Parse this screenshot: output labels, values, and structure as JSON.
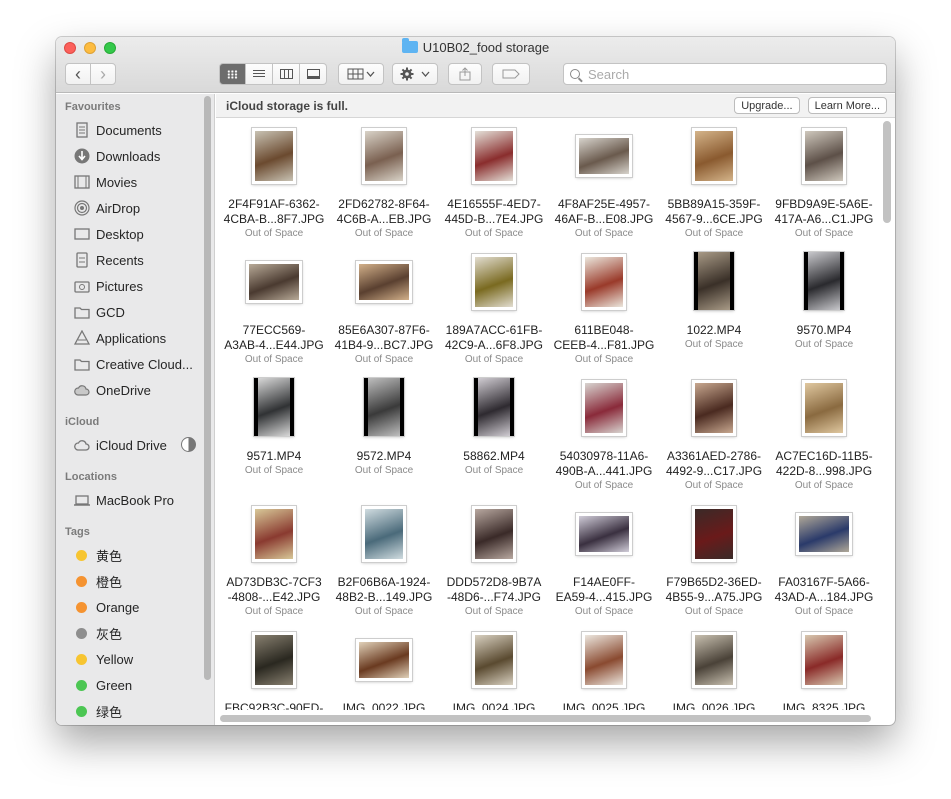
{
  "window": {
    "title": "U10B02_food storage"
  },
  "toolbar": {
    "back": "‹",
    "forward": "›",
    "search_placeholder": "Search"
  },
  "sidebar": {
    "favourites_heading": "Favourites",
    "favourites": [
      {
        "label": "Documents",
        "icon": "document-icon"
      },
      {
        "label": "Downloads",
        "icon": "download-icon"
      },
      {
        "label": "Movies",
        "icon": "film-icon"
      },
      {
        "label": "AirDrop",
        "icon": "airdrop-icon"
      },
      {
        "label": "Desktop",
        "icon": "desktop-icon"
      },
      {
        "label": "Recents",
        "icon": "clock-icon"
      },
      {
        "label": "Pictures",
        "icon": "camera-icon"
      },
      {
        "label": "GCD",
        "icon": "folder-icon"
      },
      {
        "label": "Applications",
        "icon": "applications-icon"
      },
      {
        "label": "Creative Cloud...",
        "icon": "folder-icon"
      },
      {
        "label": "OneDrive",
        "icon": "cloud-icon"
      }
    ],
    "icloud_heading": "iCloud",
    "icloud_drive": "iCloud Drive",
    "locations_heading": "Locations",
    "macbook": "MacBook Pro",
    "tags_heading": "Tags",
    "tags": [
      {
        "label": "黄色",
        "color": "#f7c531"
      },
      {
        "label": "橙色",
        "color": "#f59331"
      },
      {
        "label": "Orange",
        "color": "#f59331"
      },
      {
        "label": "灰色",
        "color": "#8e8e8e"
      },
      {
        "label": "Yellow",
        "color": "#f7c531"
      },
      {
        "label": "Green",
        "color": "#4cc653"
      },
      {
        "label": "绿色",
        "color": "#4cc653"
      }
    ]
  },
  "banner": {
    "message": "iCloud storage is full.",
    "upgrade": "Upgrade...",
    "learn_more": "Learn More..."
  },
  "files": [
    {
      "l1": "2F4F91AF-6362-",
      "l2": "4CBA-B...8F7.JPG",
      "status": "Out of Space",
      "shape": "portrait",
      "tone": [
        "#6b4a2f",
        "#c8c2b3"
      ]
    },
    {
      "l1": "2FD62782-8F64-",
      "l2": "4C6B-A...EB.JPG",
      "status": "Out of Space",
      "shape": "portrait",
      "tone": [
        "#7a6050",
        "#d9d3c8"
      ]
    },
    {
      "l1": "4E16555F-4ED7-",
      "l2": "445D-B...7E4.JPG",
      "status": "Out of Space",
      "shape": "portrait",
      "tone": [
        "#8a2d2d",
        "#e4e0d8"
      ]
    },
    {
      "l1": "4F8AF25E-4957-",
      "l2": "46AF-B...E08.JPG",
      "status": "Out of Space",
      "shape": "landscape",
      "tone": [
        "#6a5a4d",
        "#d7d3cc"
      ]
    },
    {
      "l1": "5BB89A15-359F-",
      "l2": "4567-9...6CE.JPG",
      "status": "Out of Space",
      "shape": "portrait",
      "tone": [
        "#8a5a2f",
        "#d4b48a"
      ]
    },
    {
      "l1": "9FBD9A9E-5A6E-",
      "l2": "417A-A6...C1.JPG",
      "status": "Out of Space",
      "shape": "portrait",
      "tone": [
        "#5d5048",
        "#cfc8bd"
      ]
    },
    {
      "l1": "77ECC569-",
      "l2": "A3AB-4...E44.JPG",
      "status": "Out of Space",
      "shape": "landscape",
      "tone": [
        "#4a3a30",
        "#b8aa98"
      ]
    },
    {
      "l1": "85E6A307-87F6-",
      "l2": "41B4-9...BC7.JPG",
      "status": "Out of Space",
      "shape": "landscape",
      "tone": [
        "#5a4030",
        "#d2b08a"
      ]
    },
    {
      "l1": "189A7ACC-61FB-",
      "l2": "42C9-A...6F8.JPG",
      "status": "Out of Space",
      "shape": "portrait",
      "tone": [
        "#7a6a20",
        "#e2ddd0"
      ]
    },
    {
      "l1": "611BE048-",
      "l2": "CEEB-4...F81.JPG",
      "status": "Out of Space",
      "shape": "portrait",
      "tone": [
        "#9a3a2a",
        "#ebe6dc"
      ]
    },
    {
      "l1": "1022.MP4",
      "l2": "",
      "status": "Out of Space",
      "shape": "video",
      "tone": [
        "#3a3028",
        "#a89a86"
      ]
    },
    {
      "l1": "9570.MP4",
      "l2": "",
      "status": "Out of Space",
      "shape": "video",
      "tone": [
        "#2a2a2e",
        "#c8c8cc"
      ]
    },
    {
      "l1": "9571.MP4",
      "l2": "",
      "status": "Out of Space",
      "shape": "video",
      "tone": [
        "#303234",
        "#d8d8d8"
      ]
    },
    {
      "l1": "9572.MP4",
      "l2": "",
      "status": "Out of Space",
      "shape": "video",
      "tone": [
        "#3a3a3a",
        "#bebebe"
      ]
    },
    {
      "l1": "58862.MP4",
      "l2": "",
      "status": "Out of Space",
      "shape": "video",
      "tone": [
        "#2e2a30",
        "#d0ccd2"
      ]
    },
    {
      "l1": "54030978-11A6-",
      "l2": "490B-A...441.JPG",
      "status": "Out of Space",
      "shape": "portrait",
      "tone": [
        "#8a2a3a",
        "#d8d4d0"
      ]
    },
    {
      "l1": "A3361AED-2786-",
      "l2": "4492-9...C17.JPG",
      "status": "Out of Space",
      "shape": "portrait",
      "tone": [
        "#4a2a20",
        "#c8a890"
      ]
    },
    {
      "l1": "AC7EC16D-11B5-",
      "l2": "422D-8...998.JPG",
      "status": "Out of Space",
      "shape": "portrait",
      "tone": [
        "#8a6a40",
        "#e0c8a0"
      ]
    },
    {
      "l1": "AD73DB3C-7CF3",
      "l2": "-4808-...E42.JPG",
      "status": "Out of Space",
      "shape": "portrait",
      "tone": [
        "#8a3a30",
        "#d8c898"
      ]
    },
    {
      "l1": "B2F06B6A-1924-",
      "l2": "48B2-B...149.JPG",
      "status": "Out of Space",
      "shape": "portrait",
      "tone": [
        "#4a6a7a",
        "#d0dce0"
      ]
    },
    {
      "l1": "DDD572D8-9B7A",
      "l2": "-48D6-...F74.JPG",
      "status": "Out of Space",
      "shape": "portrait",
      "tone": [
        "#3a2a28",
        "#b8a8a0"
      ]
    },
    {
      "l1": "F14AE0FF-",
      "l2": "EA59-4...415.JPG",
      "status": "Out of Space",
      "shape": "landscape",
      "tone": [
        "#3a3040",
        "#d0ccd8"
      ]
    },
    {
      "l1": "F79B65D2-36ED-",
      "l2": "4B55-9...A75.JPG",
      "status": "Out of Space",
      "shape": "portrait",
      "tone": [
        "#6a1a1a",
        "#3a2a28"
      ]
    },
    {
      "l1": "FA03167F-5A66-",
      "l2": "43AD-A...184.JPG",
      "status": "Out of Space",
      "shape": "landscape",
      "tone": [
        "#2a3a6a",
        "#b0a898"
      ]
    },
    {
      "l1": "FBC92B3C-90ED-",
      "l2": "",
      "status": "",
      "shape": "portrait",
      "tone": [
        "#2a2820",
        "#888070"
      ]
    },
    {
      "l1": "IMG_0022.JPG",
      "l2": "",
      "status": "",
      "shape": "landscape",
      "tone": [
        "#6a3a20",
        "#e0d0b8"
      ]
    },
    {
      "l1": "IMG_0024.JPG",
      "l2": "",
      "status": "",
      "shape": "portrait",
      "tone": [
        "#5a4a30",
        "#d8d0c0"
      ]
    },
    {
      "l1": "IMG_0025.JPG",
      "l2": "",
      "status": "",
      "shape": "portrait",
      "tone": [
        "#8a4a30",
        "#ece6de"
      ]
    },
    {
      "l1": "IMG_0026.JPG",
      "l2": "",
      "status": "",
      "shape": "portrait",
      "tone": [
        "#4a4238",
        "#c8c0b0"
      ]
    },
    {
      "l1": "IMG_8325.JPG",
      "l2": "",
      "status": "",
      "shape": "portrait",
      "tone": [
        "#8a2a28",
        "#d8c8b0"
      ]
    }
  ]
}
